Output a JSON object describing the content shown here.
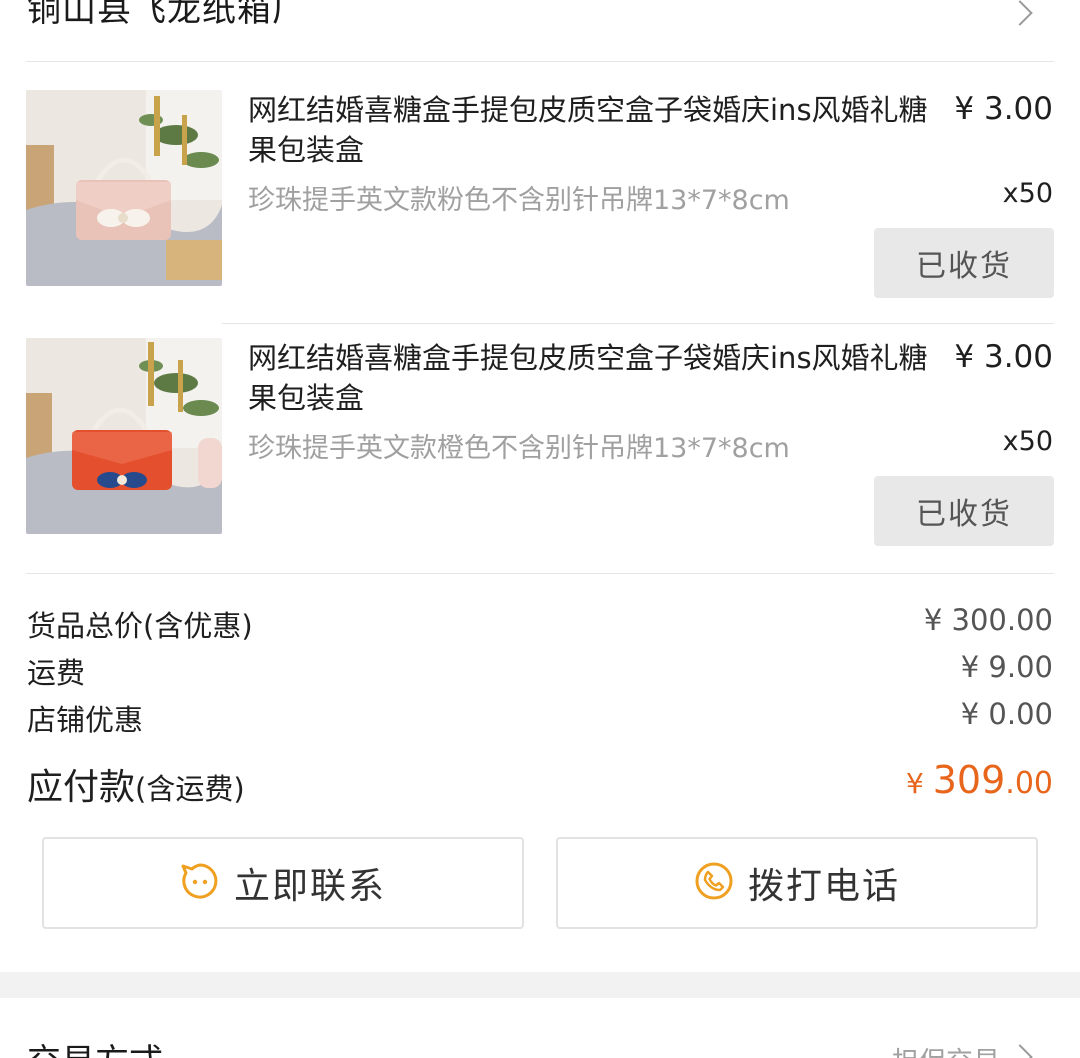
{
  "store": {
    "name": "铜山县飞龙纸箱厂"
  },
  "items": [
    {
      "title": "网红结婚喜糖盒手提包皮质空盒子袋婚庆ins风婚礼糖果包装盒",
      "price": "¥ 3.00",
      "spec": "珍珠提手英文款粉色不含别针吊牌13*7*8cm",
      "qty": "x50",
      "status": "已收货",
      "box_color": "#e9c2b8"
    },
    {
      "title": "网红结婚喜糖盒手提包皮质空盒子袋婚庆ins风婚礼糖果包装盒",
      "price": "¥ 3.00",
      "spec": "珍珠提手英文款橙色不含别针吊牌13*7*8cm",
      "qty": "x50",
      "status": "已收货",
      "box_color": "#e4502e"
    }
  ],
  "summary": {
    "goods_total_label": "货品总价(含优惠)",
    "goods_total_value": "¥ 300.00",
    "shipping_label": "运费",
    "shipping_value": "¥ 9.00",
    "store_discount_label": "店铺优惠",
    "store_discount_value": "¥ 0.00",
    "payable_label": "应付款",
    "payable_note": "(含运费)",
    "payable_currency": "¥ ",
    "payable_int": "309",
    "payable_dec": ".00"
  },
  "actions": {
    "contact_label": "立即联系",
    "call_label": "拨打电话"
  },
  "next_section": {
    "title": "交易方式",
    "value": "担保交易"
  },
  "colors": {
    "accent": "#e8651c",
    "icon": "#f0a020"
  },
  "icons": [
    "chevron-right-icon",
    "chat-face-icon",
    "phone-icon"
  ]
}
